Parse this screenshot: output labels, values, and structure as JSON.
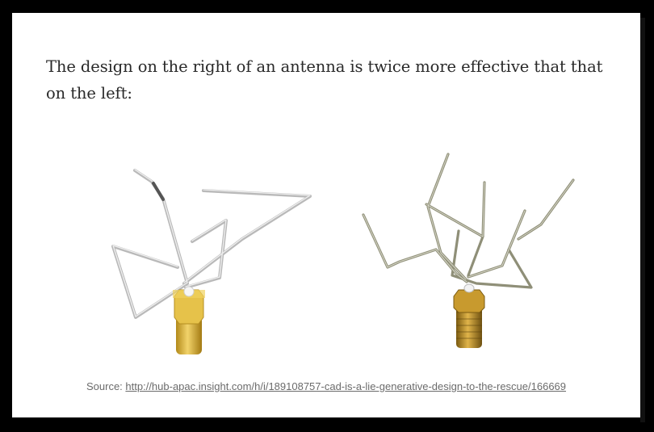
{
  "article": {
    "paragraph": "The design on the right of an antenna is twice more effective that that on the left:",
    "caption_prefix": "Source: ",
    "caption_link": "http://hub-apac.insight.com/h/i/189108757-cad-is-a-lie-generative-design-to-the-rescue/166669"
  },
  "figure": {
    "left_antenna": "conventional-antenna-illustration",
    "right_antenna": "generative-design-antenna-illustration",
    "colors": {
      "wire_left": "#c9c9c9",
      "wire_right": "#9a9a86",
      "connector_gold": "#d8b23a"
    }
  }
}
